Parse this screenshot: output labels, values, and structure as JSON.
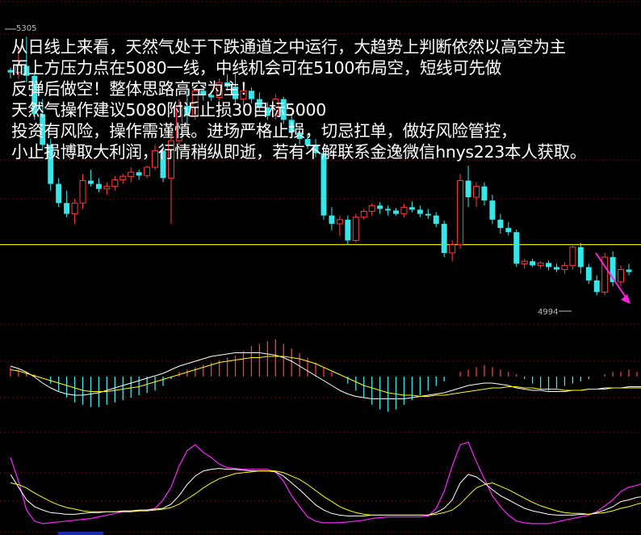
{
  "overlay_lines": [
    "从日线上来看，天然气处于下跌通道之中运行，大趋势上判断依然以高空为主",
    "而上方压力点在5080一线，中线机会可在5100布局空，短线可先做",
    "反弹后做空！整体思路高空为主！",
    "天然气操作建议5080附近止损30目标5000",
    "投资有风险，操作需谨慎。进场严格止损，切忌扛单，做好风险管控，",
    "小止损博取大利润，行情稍纵即逝，若有不解联系金逸微信hnys223本人获取。"
  ],
  "colors": {
    "up": "#ff3b3b",
    "down": "#35e6ea",
    "support_line": "#ffff00",
    "trend_arrow": "#ff22dd",
    "dif_line": "#ffffff",
    "dea_line": "#ffff00",
    "kdj_j": "#ff22ff",
    "grid": "#7a0000"
  },
  "chart_data": {
    "type": "candlestick",
    "annotations": {
      "high_label": "5305",
      "low_label": "4994"
    },
    "price_range": [
      4975,
      5320
    ],
    "support_level": 5055,
    "candles": [
      [
        5265,
        5268,
        5255,
        5262
      ],
      [
        5262,
        5290,
        5255,
        5270
      ],
      [
        5270,
        5305,
        5250,
        5258
      ],
      [
        5258,
        5262,
        5205,
        5212
      ],
      [
        5212,
        5230,
        5170,
        5175
      ],
      [
        5175,
        5182,
        5120,
        5128
      ],
      [
        5128,
        5135,
        5100,
        5105
      ],
      [
        5105,
        5120,
        5088,
        5092
      ],
      [
        5092,
        5110,
        5080,
        5105
      ],
      [
        5105,
        5140,
        5098,
        5132
      ],
      [
        5132,
        5145,
        5125,
        5128
      ],
      [
        5128,
        5135,
        5118,
        5122
      ],
      [
        5122,
        5130,
        5115,
        5125
      ],
      [
        5125,
        5138,
        5120,
        5133
      ],
      [
        5133,
        5140,
        5128,
        5137
      ],
      [
        5137,
        5148,
        5130,
        5142
      ],
      [
        5142,
        5145,
        5133,
        5138
      ],
      [
        5138,
        5150,
        5135,
        5148
      ],
      [
        5148,
        5175,
        5145,
        5168
      ],
      [
        5168,
        5175,
        5130,
        5135
      ],
      [
        5135,
        5190,
        5080,
        5180
      ],
      [
        5180,
        5230,
        5175,
        5222
      ],
      [
        5222,
        5245,
        5200,
        5210
      ],
      [
        5210,
        5245,
        5205,
        5240
      ],
      [
        5240,
        5248,
        5228,
        5235
      ],
      [
        5235,
        5240,
        5228,
        5232
      ],
      [
        5232,
        5255,
        5228,
        5250
      ],
      [
        5250,
        5260,
        5240,
        5245
      ],
      [
        5245,
        5262,
        5225,
        5230
      ],
      [
        5230,
        5248,
        5222,
        5240
      ],
      [
        5240,
        5244,
        5225,
        5230
      ],
      [
        5230,
        5238,
        5215,
        5220
      ],
      [
        5220,
        5226,
        5205,
        5210
      ],
      [
        5210,
        5236,
        5205,
        5230
      ],
      [
        5230,
        5233,
        5200,
        5205
      ],
      [
        5205,
        5212,
        5185,
        5190
      ],
      [
        5190,
        5198,
        5175,
        5182
      ],
      [
        5182,
        5188,
        5170,
        5175
      ],
      [
        5175,
        5182,
        5160,
        5165
      ],
      [
        5165,
        5170,
        5085,
        5090
      ],
      [
        5090,
        5100,
        5072,
        5080
      ],
      [
        5080,
        5090,
        5065,
        5085
      ],
      [
        5085,
        5090,
        5055,
        5060
      ],
      [
        5060,
        5092,
        5058,
        5088
      ],
      [
        5088,
        5098,
        5085,
        5095
      ],
      [
        5095,
        5105,
        5090,
        5102
      ],
      [
        5102,
        5106,
        5092,
        5098
      ],
      [
        5098,
        5102,
        5090,
        5096
      ],
      [
        5096,
        5099,
        5090,
        5092
      ],
      [
        5092,
        5104,
        5088,
        5100
      ],
      [
        5100,
        5107,
        5094,
        5097
      ],
      [
        5097,
        5102,
        5088,
        5092
      ],
      [
        5092,
        5098,
        5086,
        5090
      ],
      [
        5090,
        5094,
        5076,
        5080
      ],
      [
        5080,
        5084,
        5040,
        5045
      ],
      [
        5045,
        5060,
        5035,
        5055
      ],
      [
        5055,
        5140,
        5050,
        5132
      ],
      [
        5132,
        5150,
        5100,
        5112
      ],
      [
        5112,
        5130,
        5100,
        5125
      ],
      [
        5125,
        5130,
        5102,
        5108
      ],
      [
        5108,
        5115,
        5080,
        5085
      ],
      [
        5085,
        5092,
        5068,
        5075
      ],
      [
        5075,
        5082,
        5066,
        5070
      ],
      [
        5070,
        5073,
        5028,
        5032
      ],
      [
        5032,
        5038,
        5026,
        5035
      ],
      [
        5035,
        5038,
        5028,
        5030
      ],
      [
        5030,
        5035,
        5026,
        5033
      ],
      [
        5033,
        5036,
        5024,
        5028
      ],
      [
        5028,
        5032,
        5022,
        5025
      ],
      [
        5025,
        5034,
        5020,
        5030
      ],
      [
        5030,
        5055,
        5025,
        5052
      ],
      [
        5052,
        5057,
        5020,
        5028
      ],
      [
        5028,
        5032,
        5008,
        5012
      ],
      [
        5012,
        5018,
        4994,
        4998
      ],
      [
        4998,
        5045,
        4994,
        5040
      ],
      [
        5040,
        5047,
        5005,
        5010
      ],
      [
        5010,
        5030,
        5005,
        5025
      ],
      [
        5025,
        5032,
        5018,
        5022
      ]
    ],
    "macd_panel": {
      "histogram": [
        4,
        3,
        2,
        1,
        0,
        -3,
        -6,
        -9,
        -11,
        -12,
        -13,
        -13,
        -12,
        -11,
        -10,
        -9,
        -8,
        -7,
        -6,
        -4,
        -1,
        2,
        3,
        4,
        5,
        6,
        7,
        8,
        9,
        11,
        13,
        14,
        15,
        16,
        14,
        12,
        10,
        8,
        6,
        4,
        2,
        0,
        -3,
        -6,
        -9,
        -12,
        -14,
        -15,
        -14,
        -12,
        -10,
        -8,
        -6,
        -4,
        -2,
        0,
        2,
        3,
        4,
        5,
        4,
        3,
        2,
        1,
        -1,
        -3,
        -5,
        -6,
        -5,
        -4,
        -3,
        -2,
        -1,
        0,
        1,
        2,
        2,
        3,
        2,
        2
      ],
      "dif": [
        18,
        16,
        13,
        9,
        4,
        0,
        -3,
        -5,
        -6,
        -6,
        -5,
        -4,
        -2,
        0,
        2,
        4,
        6,
        8,
        10,
        12,
        15,
        18,
        20,
        22,
        24,
        26,
        27,
        28,
        29,
        29,
        29,
        29,
        28,
        27,
        25,
        22,
        18,
        14,
        10,
        6,
        2,
        -2,
        -5,
        -7,
        -8,
        -9,
        -9,
        -9,
        -9,
        -9,
        -8,
        -7,
        -6,
        -5,
        -4,
        -2,
        0,
        2,
        3,
        4,
        4,
        3,
        2,
        0,
        -1,
        -2,
        -2,
        -3,
        -3,
        -3,
        -2,
        -2,
        -1,
        -1,
        0,
        0,
        0,
        1,
        1,
        1
      ],
      "dea": [
        15,
        14,
        12,
        10,
        8,
        6,
        4,
        2,
        0,
        -2,
        -3,
        -3,
        -3,
        -2,
        -1,
        0,
        1,
        3,
        5,
        7,
        9,
        11,
        13,
        15,
        17,
        19,
        21,
        22,
        23,
        24,
        25,
        25,
        26,
        26,
        26,
        25,
        24,
        22,
        20,
        17,
        14,
        11,
        8,
        5,
        2,
        0,
        -2,
        -4,
        -5,
        -6,
        -6,
        -7,
        -7,
        -6,
        -6,
        -5,
        -4,
        -3,
        -2,
        -1,
        0,
        0,
        1,
        1,
        0,
        0,
        -1,
        -1,
        -1,
        -2,
        -2,
        -2,
        -1,
        -1,
        -1,
        0,
        0,
        0,
        0,
        0
      ]
    },
    "kdj_panel": {
      "range": [
        0,
        100
      ],
      "k": [
        60,
        45,
        30,
        22,
        18,
        15,
        14,
        13,
        13,
        14,
        15,
        15,
        16,
        16,
        17,
        17,
        18,
        18,
        19,
        20,
        25,
        35,
        48,
        58,
        64,
        66,
        67,
        66,
        66,
        65,
        64,
        64,
        64,
        63,
        58,
        50,
        42,
        33,
        24,
        18,
        14,
        12,
        11,
        11,
        11,
        12,
        12,
        12,
        12,
        12,
        12,
        12,
        12,
        15,
        20,
        30,
        50,
        60,
        57,
        50,
        42,
        35,
        30,
        25,
        20,
        17,
        15,
        13,
        12,
        12,
        12,
        13,
        13,
        15,
        18,
        22,
        28,
        30,
        33,
        34
      ],
      "d": [
        50,
        48,
        44,
        38,
        33,
        28,
        24,
        21,
        19,
        17,
        16,
        16,
        16,
        16,
        16,
        16,
        17,
        17,
        18,
        19,
        21,
        25,
        31,
        37,
        44,
        50,
        55,
        58,
        61,
        62,
        63,
        64,
        64,
        64,
        62,
        58,
        54,
        48,
        41,
        34,
        28,
        22,
        18,
        15,
        13,
        12,
        12,
        12,
        12,
        12,
        12,
        12,
        12,
        13,
        15,
        18,
        25,
        35,
        44,
        48,
        50,
        46,
        42,
        37,
        32,
        27,
        23,
        20,
        17,
        15,
        14,
        14,
        13,
        14,
        15,
        17,
        20,
        22,
        25,
        27
      ],
      "j": [
        80,
        52,
        18,
        5,
        2,
        3,
        4,
        5,
        6,
        7,
        8,
        10,
        12,
        14,
        16,
        16,
        17,
        18,
        20,
        30,
        45,
        70,
        88,
        95,
        86,
        80,
        72,
        68,
        67,
        66,
        66,
        66,
        66,
        63,
        52,
        35,
        22,
        10,
        5,
        3,
        3,
        3,
        4,
        5,
        6,
        8,
        9,
        10,
        10,
        10,
        10,
        10,
        11,
        20,
        40,
        70,
        95,
        98,
        75,
        55,
        35,
        22,
        12,
        5,
        3,
        2,
        2,
        2,
        4,
        6,
        8,
        10,
        12,
        16,
        23,
        30,
        40,
        45,
        47,
        50
      ]
    }
  }
}
